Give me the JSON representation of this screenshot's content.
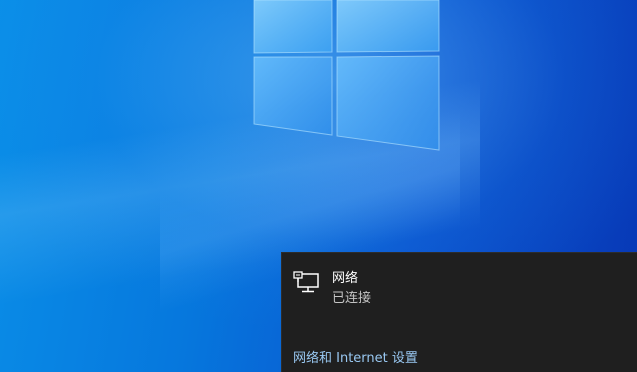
{
  "desktop": {
    "wallpaper": "windows-10-hero",
    "accent_color": "#0a78e0"
  },
  "network_flyout": {
    "background_color": "#1f1f1f",
    "network": {
      "icon": "ethernet-icon",
      "name": "网络",
      "status": "已连接"
    },
    "settings_link": {
      "label": "网络和 Internet 设置",
      "color": "#99c8f2"
    }
  }
}
